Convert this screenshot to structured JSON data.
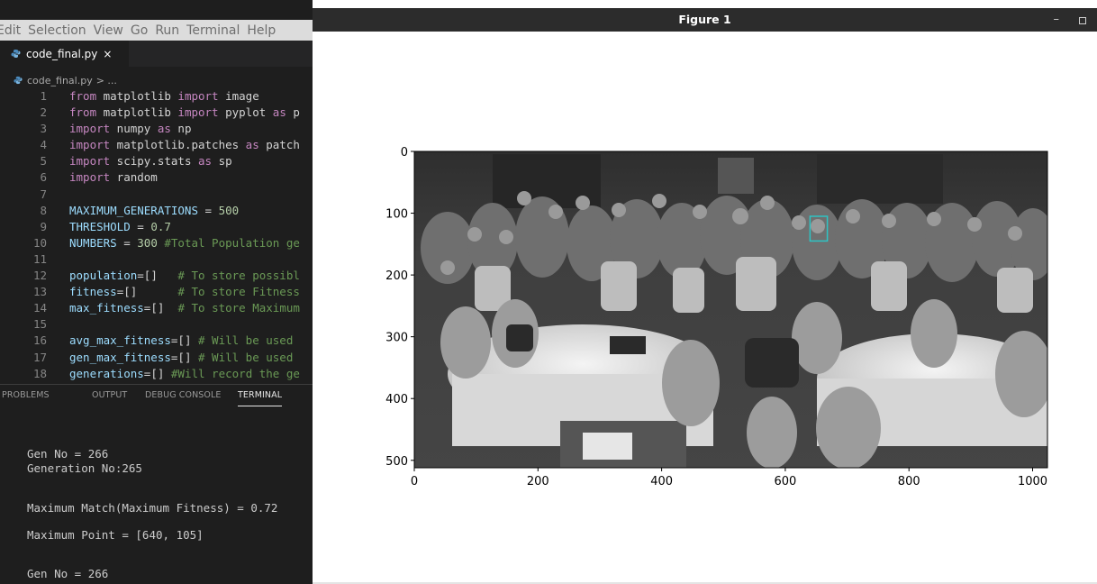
{
  "menubar": {
    "items": [
      "Edit",
      "Selection",
      "View",
      "Go",
      "Run",
      "Terminal",
      "Help"
    ]
  },
  "editor": {
    "tab": {
      "filename": "code_final.py",
      "close": "×"
    },
    "breadcrumb": {
      "file": "code_final.py",
      "rest": "> ..."
    },
    "lines": [
      {
        "n": "1",
        "tokens": [
          [
            "kw",
            "from"
          ],
          [
            "plain",
            " matplotlib "
          ],
          [
            "kw",
            "import"
          ],
          [
            "plain",
            " image"
          ]
        ]
      },
      {
        "n": "2",
        "tokens": [
          [
            "kw",
            "from"
          ],
          [
            "plain",
            " matplotlib "
          ],
          [
            "kw",
            "import"
          ],
          [
            "plain",
            " pyplot "
          ],
          [
            "kw",
            "as"
          ],
          [
            "plain",
            " p"
          ]
        ]
      },
      {
        "n": "3",
        "tokens": [
          [
            "kw",
            "import"
          ],
          [
            "plain",
            " numpy "
          ],
          [
            "kw",
            "as"
          ],
          [
            "plain",
            " np"
          ]
        ]
      },
      {
        "n": "4",
        "tokens": [
          [
            "kw",
            "import"
          ],
          [
            "plain",
            " matplotlib.patches "
          ],
          [
            "kw",
            "as"
          ],
          [
            "plain",
            " patch"
          ]
        ]
      },
      {
        "n": "5",
        "tokens": [
          [
            "kw",
            "import"
          ],
          [
            "plain",
            " scipy.stats "
          ],
          [
            "kw",
            "as"
          ],
          [
            "plain",
            " sp"
          ]
        ]
      },
      {
        "n": "6",
        "tokens": [
          [
            "kw",
            "import"
          ],
          [
            "plain",
            " random"
          ]
        ]
      },
      {
        "n": "7",
        "tokens": []
      },
      {
        "n": "8",
        "tokens": [
          [
            "var",
            "MAXIMUM_GENERATIONS"
          ],
          [
            "plain",
            " = "
          ],
          [
            "num",
            "500"
          ]
        ]
      },
      {
        "n": "9",
        "tokens": [
          [
            "var",
            "THRESHOLD"
          ],
          [
            "plain",
            " = "
          ],
          [
            "num",
            "0.7"
          ]
        ]
      },
      {
        "n": "10",
        "tokens": [
          [
            "var",
            "NUMBERS"
          ],
          [
            "plain",
            " = "
          ],
          [
            "num",
            "300"
          ],
          [
            "plain",
            " "
          ],
          [
            "cm",
            "#Total Population ge"
          ]
        ]
      },
      {
        "n": "11",
        "tokens": []
      },
      {
        "n": "12",
        "tokens": [
          [
            "var",
            "population"
          ],
          [
            "plain",
            "=[]   "
          ],
          [
            "cm",
            "# To store possibl"
          ]
        ]
      },
      {
        "n": "13",
        "tokens": [
          [
            "var",
            "fitness"
          ],
          [
            "plain",
            "=[]      "
          ],
          [
            "cm",
            "# To store Fitness"
          ]
        ]
      },
      {
        "n": "14",
        "tokens": [
          [
            "var",
            "max_fitness"
          ],
          [
            "plain",
            "=[]  "
          ],
          [
            "cm",
            "# To store Maximum"
          ]
        ]
      },
      {
        "n": "15",
        "tokens": []
      },
      {
        "n": "16",
        "tokens": [
          [
            "var",
            "avg_max_fitness"
          ],
          [
            "plain",
            "=[] "
          ],
          [
            "cm",
            "# Will be used"
          ]
        ]
      },
      {
        "n": "17",
        "tokens": [
          [
            "var",
            "gen_max_fitness"
          ],
          [
            "plain",
            "=[] "
          ],
          [
            "cm",
            "# Will be used"
          ]
        ]
      },
      {
        "n": "18",
        "tokens": [
          [
            "var",
            "generations"
          ],
          [
            "plain",
            "=[] "
          ],
          [
            "cm",
            "#Will record the ge"
          ]
        ]
      }
    ]
  },
  "panel": {
    "tabs": [
      "PROBLEMS",
      "OUTPUT",
      "DEBUG CONSOLE",
      "TERMINAL"
    ],
    "active_tab": "TERMINAL"
  },
  "terminal": {
    "lines": [
      "Gen No = 266",
      "Generation No:265",
      "Maximum Match(Maximum Fitness) = 0.72",
      "Maximum Point = [640, 105]",
      "Gen No = 266"
    ]
  },
  "figure": {
    "title": "Figure 1",
    "controls": {
      "minimize": "–"
    },
    "plot": {
      "image_description": "grayscale group photo of a conference audience",
      "highlight": {
        "x": 640,
        "y": 105,
        "color": "#2ec4c4"
      },
      "x_ticks": [
        "0",
        "200",
        "400",
        "600",
        "800",
        "1000"
      ],
      "y_ticks": [
        "0",
        "100",
        "200",
        "300",
        "400",
        "500"
      ]
    }
  }
}
